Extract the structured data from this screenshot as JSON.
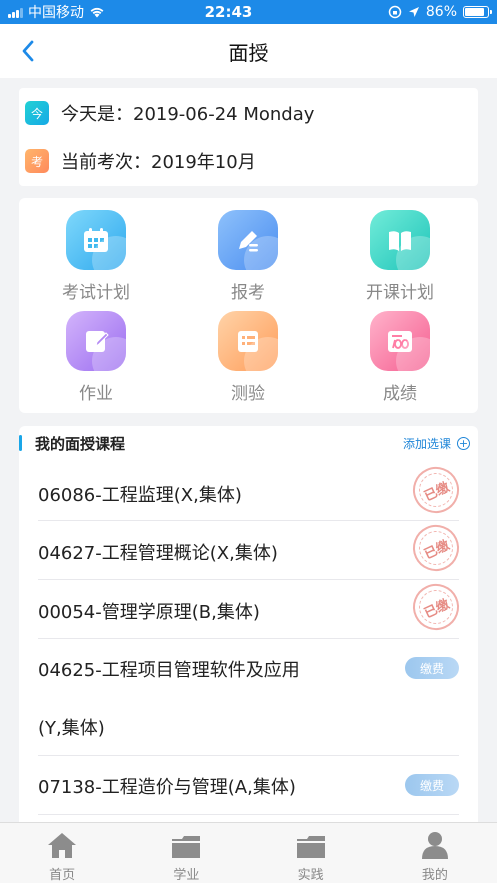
{
  "status_bar": {
    "carrier": "中国移动",
    "time": "22:43",
    "battery_percent": "86%",
    "battery_level": 0.86
  },
  "nav": {
    "back_icon": "chevron-left-icon",
    "title": "面授"
  },
  "info": {
    "today_icon_text": "今",
    "today_text": "今天是：2019-06-24 Monday",
    "exam_icon_text": "考",
    "exam_text": "当前考次：2019年10月"
  },
  "features": [
    {
      "label": "考试计划",
      "icon": "calendar-icon",
      "color": "#3fb9ef"
    },
    {
      "label": "报考",
      "icon": "pen-icon",
      "color": "#5a9ff0"
    },
    {
      "label": "开课计划",
      "icon": "book-icon",
      "color": "#2fd4c5"
    },
    {
      "label": "作业",
      "icon": "edit-icon",
      "color": "#b38af3"
    },
    {
      "label": "测验",
      "icon": "quiz-icon",
      "color": "#ffb17a"
    },
    {
      "label": "成绩",
      "icon": "score-icon",
      "color": "#ff7ea6"
    }
  ],
  "courses": {
    "title": "我的面授课程",
    "add_label": "添加选课",
    "add_icon": "plus-circle-icon",
    "items": [
      {
        "name": "06086-工程监理(X,集体)",
        "status": "paid",
        "stamp_text": "已缴"
      },
      {
        "name": "04627-工程管理概论(X,集体)",
        "status": "paid",
        "stamp_text": "已缴"
      },
      {
        "name": "00054-管理学原理(B,集体)",
        "status": "paid",
        "stamp_text": "已缴"
      },
      {
        "name_line1": "04625-工程项目管理软件及应用",
        "name_line2": "(Y,集体)",
        "status": "unpaid",
        "pay_label": "缴费"
      },
      {
        "name": "07138-工程造价与管理(A,集体)",
        "status": "unpaid",
        "pay_label": "缴费"
      }
    ]
  },
  "tabbar": [
    {
      "label": "首页",
      "icon": "home-icon"
    },
    {
      "label": "学业",
      "icon": "folder-icon"
    },
    {
      "label": "实践",
      "icon": "folder-icon"
    },
    {
      "label": "我的",
      "icon": "user-icon"
    }
  ]
}
